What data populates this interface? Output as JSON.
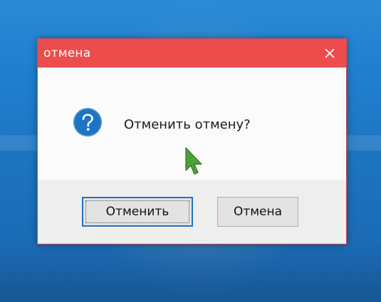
{
  "dialog": {
    "title": "отмена",
    "message": "Отменить отмену?",
    "ok_label": "Отменить",
    "cancel_label": "Отмена"
  },
  "icons": {
    "close": "close-icon",
    "question": "question-icon",
    "cursor": "mouse-cursor-icon"
  },
  "colors": {
    "titlebar": "#ec4c4c",
    "accent_focus": "#1f74c6",
    "question_icon": "#1d74c4",
    "cursor": "#4ca23c"
  }
}
